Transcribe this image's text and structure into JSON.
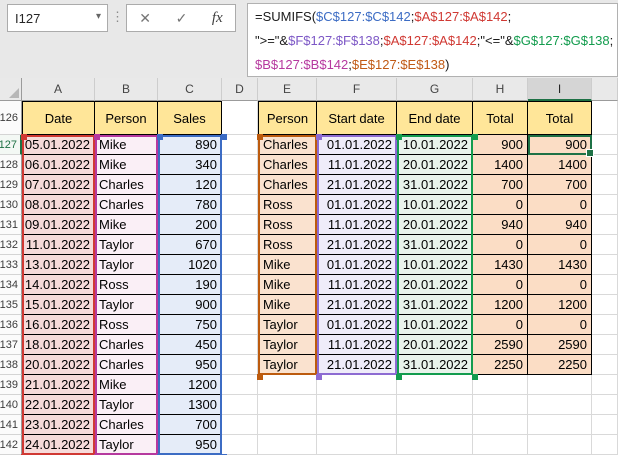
{
  "name_box": "I127",
  "formula_buttons": {
    "cancel": "✕",
    "enter": "✓",
    "fx": "fx"
  },
  "formula": {
    "lines": [
      [
        {
          "t": "=SUMIFS(",
          "c": "#1a1a1a"
        },
        {
          "t": "$C$127:$C$142",
          "c": "#3c6cc4"
        },
        {
          "t": ";",
          "c": "#1a1a1a"
        },
        {
          "t": "$A$127:$A$142",
          "c": "#d03933"
        },
        {
          "t": ";",
          "c": "#1a1a1a"
        }
      ],
      [
        {
          "t": "\">=\"&",
          "c": "#1a1a1a"
        },
        {
          "t": "$F$127:$F$138",
          "c": "#7d58c6"
        },
        {
          "t": ";",
          "c": "#1a1a1a"
        },
        {
          "t": "$A$127:$A$142",
          "c": "#d03933"
        },
        {
          "t": ";",
          "c": "#1a1a1a"
        },
        {
          "t": "\"<=\"&",
          "c": "#1a1a1a"
        },
        {
          "t": "$G$127:$G$138",
          "c": "#139c4e"
        },
        {
          "t": ";",
          "c": "#1a1a1a"
        }
      ],
      [
        {
          "t": "$B$127:$B$142",
          "c": "#b6399f"
        },
        {
          "t": ";",
          "c": "#1a1a1a"
        },
        {
          "t": "$E$127:$E$138",
          "c": "#c05a15"
        },
        {
          "t": ")",
          "c": "#1a1a1a"
        }
      ]
    ]
  },
  "columns": [
    {
      "letter": "A"
    },
    {
      "letter": "B"
    },
    {
      "letter": "C"
    },
    {
      "letter": "D"
    },
    {
      "letter": "E"
    },
    {
      "letter": "F"
    },
    {
      "letter": "G"
    },
    {
      "letter": "H"
    },
    {
      "letter": "I",
      "selected": true
    },
    {
      "letter": ""
    }
  ],
  "header_row": {
    "number": "126",
    "cells": {
      "A": "Date",
      "B": "Person",
      "C": "Sales",
      "D": "",
      "E": "Person",
      "F": "Start date",
      "G": "End date",
      "H": "Total",
      "I": "Total"
    }
  },
  "left_table": [
    {
      "row": "127",
      "date": "05.01.2022",
      "person": "Mike",
      "sales": "890"
    },
    {
      "row": "128",
      "date": "06.01.2022",
      "person": "Mike",
      "sales": "340"
    },
    {
      "row": "129",
      "date": "07.01.2022",
      "person": "Charles",
      "sales": "120"
    },
    {
      "row": "130",
      "date": "08.01.2022",
      "person": "Charles",
      "sales": "780"
    },
    {
      "row": "131",
      "date": "09.01.2022",
      "person": "Mike",
      "sales": "200"
    },
    {
      "row": "132",
      "date": "11.01.2022",
      "person": "Taylor",
      "sales": "670"
    },
    {
      "row": "133",
      "date": "13.01.2022",
      "person": "Taylor",
      "sales": "1020"
    },
    {
      "row": "134",
      "date": "14.01.2022",
      "person": "Ross",
      "sales": "190"
    },
    {
      "row": "135",
      "date": "15.01.2022",
      "person": "Taylor",
      "sales": "900"
    },
    {
      "row": "136",
      "date": "16.01.2022",
      "person": "Ross",
      "sales": "750"
    },
    {
      "row": "137",
      "date": "18.01.2022",
      "person": "Charles",
      "sales": "450"
    },
    {
      "row": "138",
      "date": "20.01.2022",
      "person": "Charles",
      "sales": "950"
    },
    {
      "row": "139",
      "date": "21.01.2022",
      "person": "Mike",
      "sales": "1200"
    },
    {
      "row": "140",
      "date": "22.01.2022",
      "person": "Taylor",
      "sales": "1300"
    },
    {
      "row": "141",
      "date": "23.01.2022",
      "person": "Charles",
      "sales": "700"
    },
    {
      "row": "142",
      "date": "24.01.2022",
      "person": "Taylor",
      "sales": "950"
    }
  ],
  "right_table": [
    {
      "row": "127",
      "person": "Charles",
      "start": "01.01.2022",
      "end": "10.01.2022",
      "total_h": "900",
      "total_i": "900"
    },
    {
      "row": "128",
      "person": "Charles",
      "start": "11.01.2022",
      "end": "20.01.2022",
      "total_h": "1400",
      "total_i": "1400"
    },
    {
      "row": "129",
      "person": "Charles",
      "start": "21.01.2022",
      "end": "31.01.2022",
      "total_h": "700",
      "total_i": "700"
    },
    {
      "row": "130",
      "person": "Ross",
      "start": "01.01.2022",
      "end": "10.01.2022",
      "total_h": "0",
      "total_i": "0"
    },
    {
      "row": "131",
      "person": "Ross",
      "start": "11.01.2022",
      "end": "20.01.2022",
      "total_h": "940",
      "total_i": "940"
    },
    {
      "row": "132",
      "person": "Ross",
      "start": "21.01.2022",
      "end": "31.01.2022",
      "total_h": "0",
      "total_i": "0"
    },
    {
      "row": "133",
      "person": "Mike",
      "start": "01.01.2022",
      "end": "10.01.2022",
      "total_h": "1430",
      "total_i": "1430"
    },
    {
      "row": "134",
      "person": "Mike",
      "start": "11.01.2022",
      "end": "20.01.2022",
      "total_h": "0",
      "total_i": "0"
    },
    {
      "row": "135",
      "person": "Mike",
      "start": "21.01.2022",
      "end": "31.01.2022",
      "total_h": "1200",
      "total_i": "1200"
    },
    {
      "row": "136",
      "person": "Taylor",
      "start": "01.01.2022",
      "end": "10.01.2022",
      "total_h": "0",
      "total_i": "0"
    },
    {
      "row": "137",
      "person": "Taylor",
      "start": "11.01.2022",
      "end": "20.01.2022",
      "total_h": "2590",
      "total_i": "2590"
    },
    {
      "row": "138",
      "person": "Taylor",
      "start": "21.01.2022",
      "end": "31.01.2022",
      "total_h": "2250",
      "total_i": "2250"
    }
  ],
  "ranges": [
    {
      "ref": "A127:A142",
      "col": "A",
      "rows": 16,
      "border": "#d03933",
      "fill": "#f6dbda"
    },
    {
      "ref": "B127:B142",
      "col": "B",
      "rows": 16,
      "border": "#b6399f",
      "fill": "#faeff6"
    },
    {
      "ref": "C127:C142",
      "col": "C",
      "rows": 16,
      "border": "#3c6cc4",
      "fill": "#e5ecf8"
    },
    {
      "ref": "E127:E138",
      "col": "E",
      "rows": 12,
      "border": "#bc5b0e",
      "fill": "#fae2cf"
    },
    {
      "ref": "F127:F138",
      "col": "F",
      "rows": 12,
      "border": "#8d6bd2",
      "fill": "#efecf9"
    },
    {
      "ref": "G127:G138",
      "col": "G",
      "rows": 12,
      "border": "#139c4e",
      "fill": "#e9f3eb"
    }
  ],
  "active_cell": {
    "ref": "I127",
    "col": "I",
    "row": "127",
    "value": "900"
  },
  "colors": {
    "header_fill": "#ffe699",
    "total_fill": "#fbddc5",
    "selection_green": "#1e7145",
    "chrome_bg": "#e8e8e8",
    "grid_line": "#d9d9d9"
  }
}
